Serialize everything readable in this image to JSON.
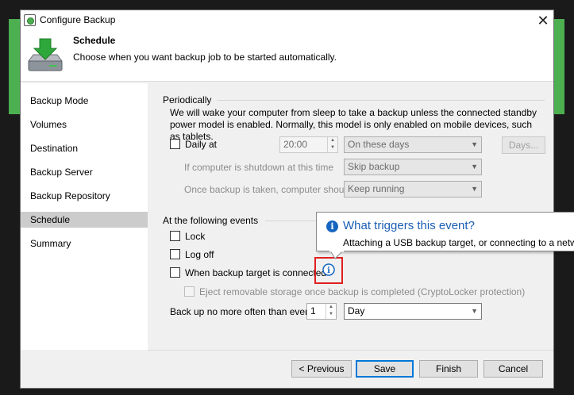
{
  "window": {
    "title": "Configure Backup"
  },
  "header": {
    "title": "Schedule",
    "subtitle": "Choose when you want backup job to be started automatically."
  },
  "sidebar": {
    "items": [
      {
        "label": "Backup Mode"
      },
      {
        "label": "Volumes"
      },
      {
        "label": "Destination"
      },
      {
        "label": "Backup Server"
      },
      {
        "label": "Backup Repository"
      },
      {
        "label": "Schedule",
        "selected": true
      },
      {
        "label": "Summary"
      }
    ]
  },
  "periodically": {
    "label": "Periodically",
    "description": "We will wake your computer from sleep to take a backup unless the connected standby power model is enabled. Normally, this model is only enabled on mobile devices, such as tablets.",
    "daily_label": "Daily at",
    "daily_checked": false,
    "time_value": "20:00",
    "days_combo": "On these days",
    "days_button": "Days...",
    "shutdown_label": "If computer is shutdown at this time",
    "shutdown_value": "Skip backup",
    "after_label": "Once backup is taken, computer should",
    "after_value": "Keep running"
  },
  "events": {
    "label": "At the following events",
    "lock_label": "Lock",
    "logoff_label": "Log off",
    "connected_label": "When backup target is connected",
    "eject_label": "Eject removable storage once backup is completed (CryptoLocker protection)",
    "often_label": "Back up no more often than every",
    "often_value": "1",
    "often_unit": "Day"
  },
  "tooltip": {
    "title": "What triggers this event?",
    "body": "Attaching a USB backup target, or connecting to a netw"
  },
  "buttons": {
    "previous": "< Previous",
    "save": "Save",
    "finish": "Finish",
    "cancel": "Cancel"
  },
  "colors": {
    "accent": "#0078d7",
    "highlight": "#e02020",
    "brand": "#4caf50"
  }
}
